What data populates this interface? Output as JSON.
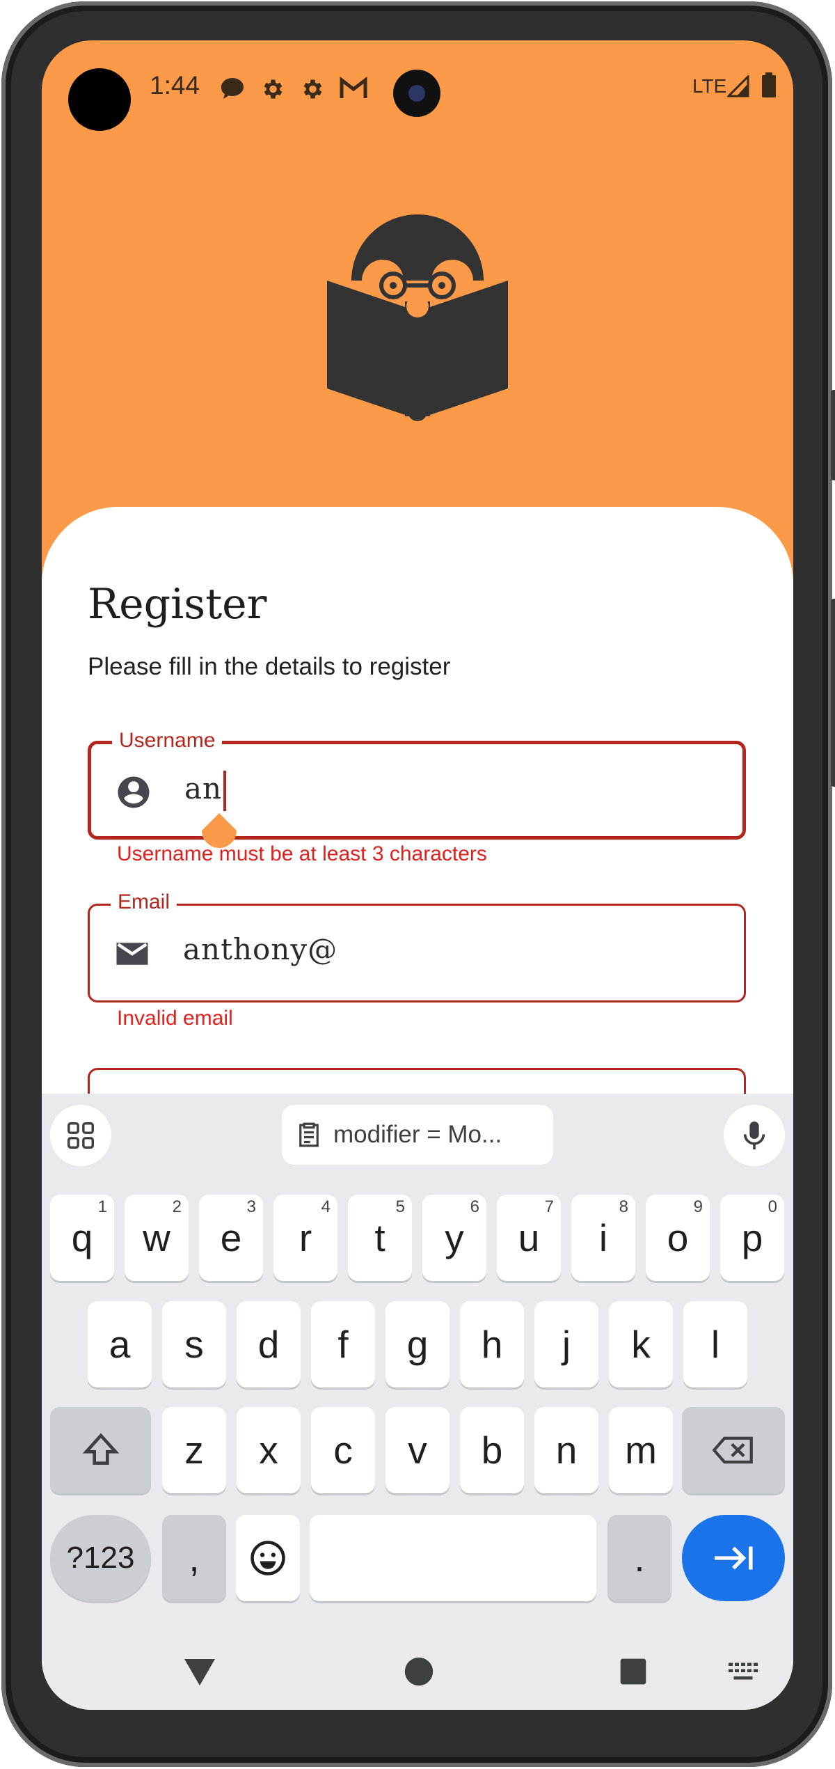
{
  "status_bar": {
    "time": "1:44",
    "network": "LTE"
  },
  "header": {
    "title": "Register",
    "subtitle": "Please fill in the details to register"
  },
  "form": {
    "username": {
      "label": "Username",
      "value": "an",
      "error": "Username must be at least 3 characters",
      "icon": "account-circle-icon"
    },
    "email": {
      "label": "Email",
      "value": "anthony@",
      "error": "Invalid email",
      "icon": "mail-icon"
    }
  },
  "keyboard": {
    "suggestion": "modifier = Mo...",
    "row1": [
      {
        "k": "q",
        "h": "1"
      },
      {
        "k": "w",
        "h": "2"
      },
      {
        "k": "e",
        "h": "3"
      },
      {
        "k": "r",
        "h": "4"
      },
      {
        "k": "t",
        "h": "5"
      },
      {
        "k": "y",
        "h": "6"
      },
      {
        "k": "u",
        "h": "7"
      },
      {
        "k": "i",
        "h": "8"
      },
      {
        "k": "o",
        "h": "9"
      },
      {
        "k": "p",
        "h": "0"
      }
    ],
    "row2": [
      "a",
      "s",
      "d",
      "f",
      "g",
      "h",
      "j",
      "k",
      "l"
    ],
    "row3": [
      "z",
      "x",
      "c",
      "v",
      "b",
      "n",
      "m"
    ],
    "symbols_label": "?123",
    "comma": ",",
    "period": "."
  },
  "colors": {
    "accent": "#FB9A48",
    "error": "#B3261E",
    "keyboard_bg": "#E8EAED",
    "enter": "#1A73E8"
  }
}
